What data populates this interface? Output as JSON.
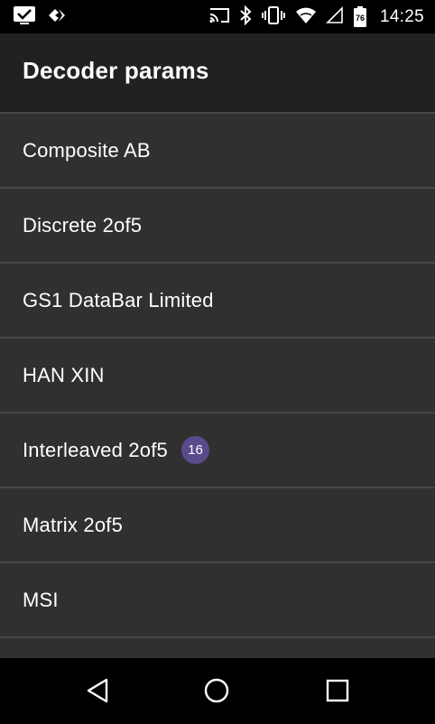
{
  "status_bar": {
    "time": "14:25",
    "battery_level": "76",
    "icons": [
      "checkbox-notification-icon",
      "diamond-arrows-icon",
      "cast-icon",
      "bluetooth-icon",
      "vibrate-icon",
      "wifi-icon",
      "cellular-signal-icon",
      "battery-icon"
    ]
  },
  "app_bar": {
    "title": "Decoder params"
  },
  "list": {
    "items": [
      {
        "label": "Composite AB"
      },
      {
        "label": "Discrete 2of5"
      },
      {
        "label": "GS1 DataBar Limited"
      },
      {
        "label": "HAN XIN"
      },
      {
        "label": "Interleaved 2of5",
        "badge": "16"
      },
      {
        "label": "Matrix 2of5"
      },
      {
        "label": "MSI"
      }
    ]
  },
  "nav_bar": {
    "icons": [
      "back-icon",
      "home-icon",
      "recents-icon"
    ]
  },
  "colors": {
    "list_background": "#303030",
    "app_bar_background": "#212121",
    "divider": "#474747",
    "badge": "#5b4a8b"
  }
}
